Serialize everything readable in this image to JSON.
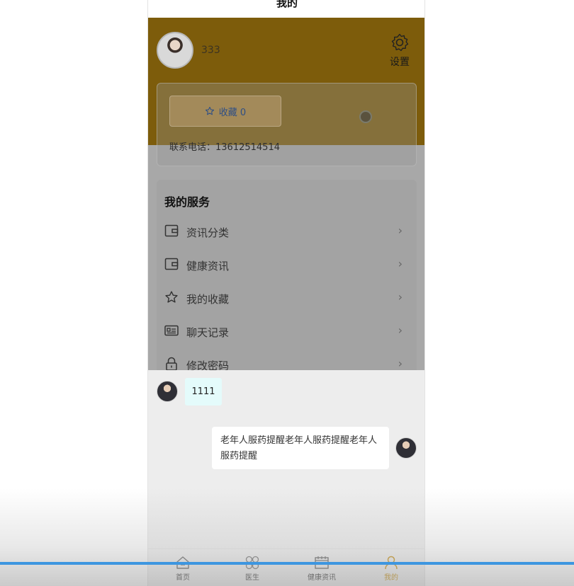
{
  "header": {
    "title": "我的"
  },
  "profile": {
    "username": "333",
    "settings_label": "设置",
    "favorites_label": "收藏 0",
    "phone_label": "联系电话：13612514514"
  },
  "services": {
    "title": "我的服务",
    "items": [
      {
        "label": "资讯分类",
        "icon": "wallet-icon"
      },
      {
        "label": "健康资讯",
        "icon": "wallet-icon"
      },
      {
        "label": "我的收藏",
        "icon": "star-icon"
      },
      {
        "label": "聊天记录",
        "icon": "id-card-icon"
      },
      {
        "label": "修改密码",
        "icon": "lock-icon"
      }
    ]
  },
  "chat": {
    "messages": [
      {
        "side": "left",
        "text": "1111"
      },
      {
        "side": "right",
        "text": "老年人服药提醒老年人服药提醒老年人服药提醒"
      }
    ]
  },
  "tabbar": {
    "items": [
      {
        "label": "首页",
        "icon": "home-icon"
      },
      {
        "label": "医生",
        "icon": "doctor-icon"
      },
      {
        "label": "健康资讯",
        "icon": "news-icon"
      },
      {
        "label": "我的",
        "icon": "user-icon",
        "active": true
      }
    ]
  },
  "colors": {
    "banner": "#7d5c0b",
    "active_tab": "#c8931a",
    "progress": "#3d96e0"
  }
}
